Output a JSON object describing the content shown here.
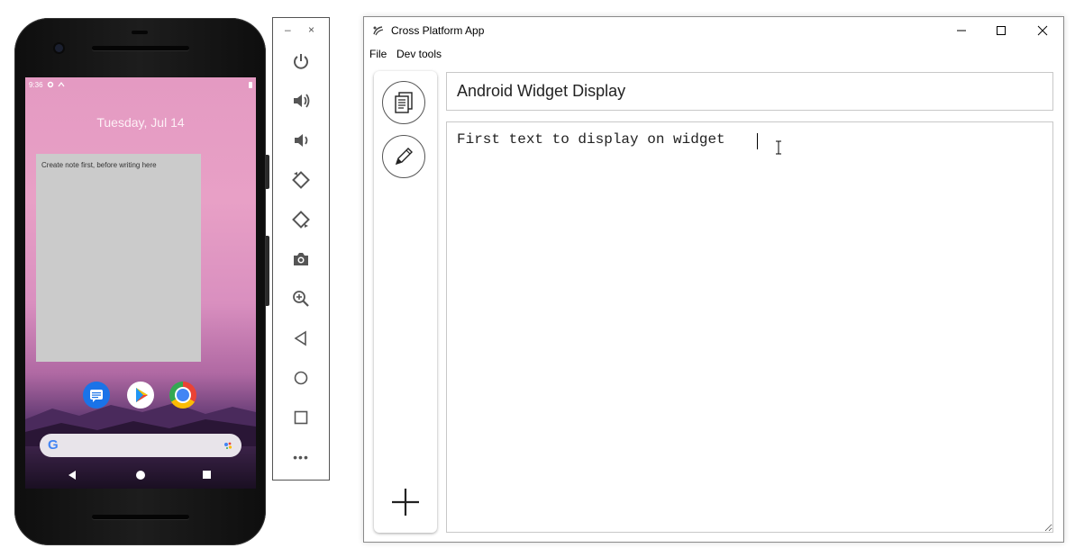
{
  "phone": {
    "status_time": "9:36",
    "date": "Tuesday, Jul 14",
    "widget_text": "Create note first, before writing here",
    "search_logo": "G",
    "apps": [
      "messages-icon",
      "play-store-icon",
      "chrome-icon"
    ],
    "nav": [
      "back-icon",
      "home-icon",
      "recents-icon"
    ]
  },
  "emulator_toolbar": {
    "minimize": "–",
    "close": "×",
    "buttons": [
      "power-icon",
      "volume-up-icon",
      "volume-down-icon",
      "rotate-left-icon",
      "rotate-right-icon",
      "camera-icon",
      "zoom-icon",
      "back-icon",
      "home-icon",
      "overview-icon",
      "more-icon"
    ],
    "more": "•••"
  },
  "window": {
    "title": "Cross Platform App",
    "controls": {
      "minimize": "—",
      "maximize": "☐",
      "close": "✕"
    },
    "menu": {
      "file": "File",
      "dev_tools": "Dev tools"
    },
    "sidebar": [
      "documents-icon",
      "pencil-icon",
      "plus-icon"
    ],
    "title_input_value": "Android Widget Display",
    "note_text": "First text to display on widget"
  },
  "colors": {
    "wallpaper_top": "#e49ac2",
    "widget_bg": "#cbcbcb",
    "window_bg": "#ffffff",
    "border": "#c8c8c8"
  }
}
